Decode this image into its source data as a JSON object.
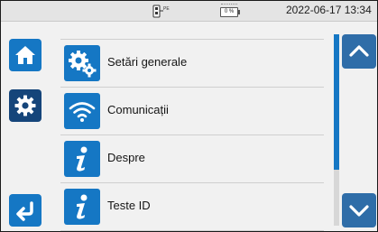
{
  "status_bar": {
    "plug_label": "PE",
    "battery_percent": "0 %",
    "datetime": "2022-06-17  13:34",
    "icons": [
      "plug-icon",
      "battery-icon"
    ]
  },
  "left_nav": {
    "items": [
      {
        "icon": "home-icon"
      },
      {
        "icon": "gear-icon",
        "selected": true
      },
      {
        "icon": "back-arrow-icon"
      }
    ]
  },
  "menu": {
    "items": [
      {
        "icon": "gears-icon",
        "label": "Setări generale"
      },
      {
        "icon": "wifi-icon",
        "label": "Comunicații"
      },
      {
        "icon": "info-icon",
        "label": "Despre"
      },
      {
        "icon": "info-icon",
        "label": "Teste ID"
      }
    ]
  },
  "scroll": {
    "icons": [
      "chevron-up-icon",
      "chevron-down-icon"
    ]
  },
  "colors": {
    "accent": "#1577c4",
    "selected": "#15457a",
    "scroll_button": "#2f6da8",
    "background": "#f1f1f1"
  }
}
